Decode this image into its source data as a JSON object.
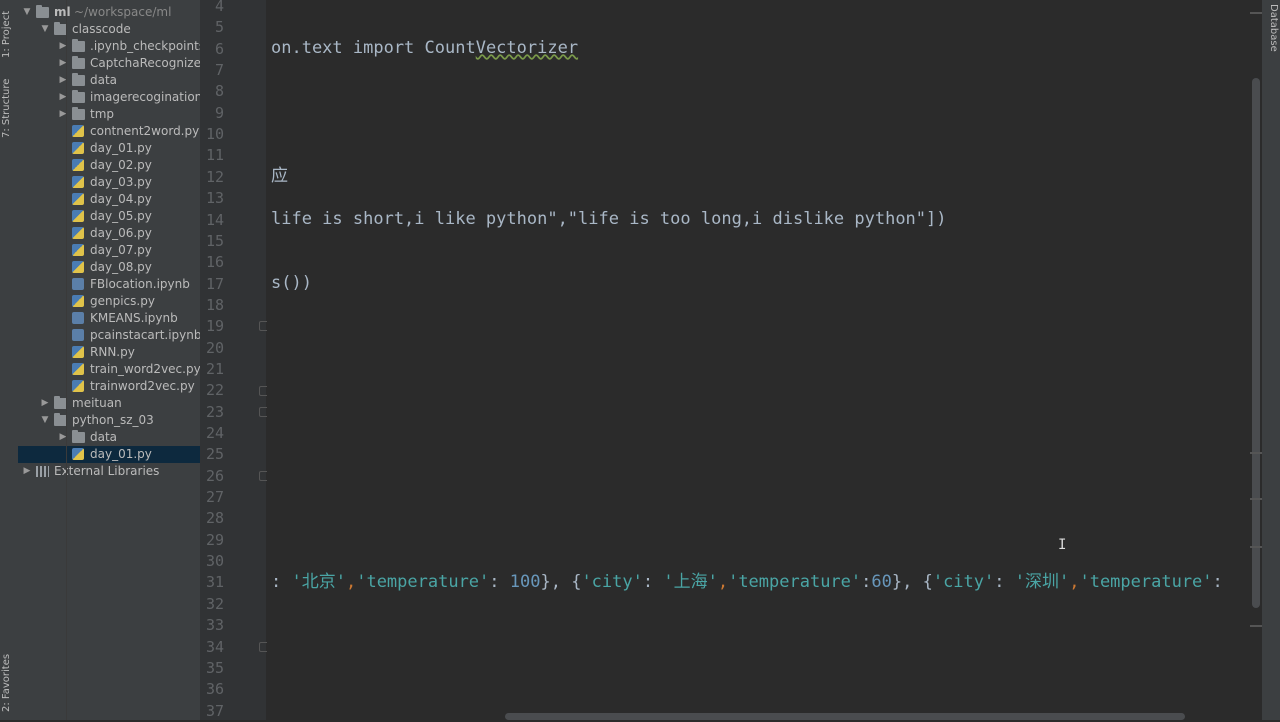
{
  "tool_windows": {
    "project_tab": "1: Project",
    "structure_tab": "7: Structure",
    "favorites_tab": "2: Favorites",
    "database_tab": "Database"
  },
  "project_tree": [
    {
      "label": "ml",
      "sub": "~/workspace/ml",
      "type": "folder",
      "arrow": "▼",
      "depth": 0
    },
    {
      "label": "classcode",
      "type": "folder",
      "arrow": "▼",
      "depth": 1
    },
    {
      "label": ".ipynb_checkpoints",
      "type": "folder",
      "arrow": "▶",
      "depth": 2
    },
    {
      "label": "CaptchaRecognize",
      "type": "folder",
      "arrow": "▶",
      "depth": 2
    },
    {
      "label": "data",
      "type": "folder",
      "arrow": "▶",
      "depth": 2
    },
    {
      "label": "imagerecogination",
      "type": "folder",
      "arrow": "▶",
      "depth": 2
    },
    {
      "label": "tmp",
      "type": "folder",
      "arrow": "▶",
      "depth": 2
    },
    {
      "label": "contnent2word.py",
      "type": "py",
      "depth": 2
    },
    {
      "label": "day_01.py",
      "type": "py",
      "depth": 2
    },
    {
      "label": "day_02.py",
      "type": "py",
      "depth": 2
    },
    {
      "label": "day_03.py",
      "type": "py",
      "depth": 2
    },
    {
      "label": "day_04.py",
      "type": "py",
      "depth": 2
    },
    {
      "label": "day_05.py",
      "type": "py",
      "depth": 2
    },
    {
      "label": "day_06.py",
      "type": "py",
      "depth": 2
    },
    {
      "label": "day_07.py",
      "type": "py",
      "depth": 2
    },
    {
      "label": "day_08.py",
      "type": "py",
      "depth": 2
    },
    {
      "label": "FBlocation.ipynb",
      "type": "nb",
      "depth": 2
    },
    {
      "label": "genpics.py",
      "type": "py",
      "depth": 2
    },
    {
      "label": "KMEANS.ipynb",
      "type": "nb",
      "depth": 2
    },
    {
      "label": "pcainstacart.ipynb",
      "type": "nb",
      "depth": 2
    },
    {
      "label": "RNN.py",
      "type": "py",
      "depth": 2
    },
    {
      "label": "train_word2vec.py",
      "type": "py",
      "depth": 2
    },
    {
      "label": "trainword2vec.py",
      "type": "py",
      "depth": 2
    },
    {
      "label": "meituan",
      "type": "folder",
      "arrow": "▶",
      "depth": 1
    },
    {
      "label": "python_sz_03",
      "type": "folder",
      "arrow": "▼",
      "depth": 1
    },
    {
      "label": "data",
      "type": "folder",
      "arrow": "▶",
      "depth": 2
    },
    {
      "label": "day_01.py",
      "type": "py",
      "depth": 2,
      "selected": true
    },
    {
      "label": "External Libraries",
      "type": "lib",
      "arrow": "▶",
      "depth": 0
    }
  ],
  "line_numbers": [
    "4",
    "5",
    "6",
    "7",
    "8",
    "9",
    "10",
    "11",
    "12",
    "13",
    "14",
    "15",
    "16",
    "17",
    "18",
    "19",
    "20",
    "21",
    "22",
    "23",
    "24",
    "25",
    "26",
    "27",
    "28",
    "29",
    "30",
    "31",
    "32",
    "33",
    "34",
    "35",
    "36",
    "37"
  ],
  "code": {
    "line6": "on.text import Count",
    "line6_wavy": "Vectorizer",
    "line12": "应",
    "line14": "life is short,i like python\",\"life is too long,i dislike python\"])",
    "line17": "s())",
    "line31": [
      {
        "t": ": ",
        "c": "plain"
      },
      {
        "t": "'北京'",
        "c": "str"
      },
      {
        "t": ",",
        "c": "punc"
      },
      {
        "t": "'temperature'",
        "c": "str"
      },
      {
        "t": ": ",
        "c": "plain"
      },
      {
        "t": "100",
        "c": "num"
      },
      {
        "t": "}, {",
        "c": "plain"
      },
      {
        "t": "'city'",
        "c": "str"
      },
      {
        "t": ": ",
        "c": "plain"
      },
      {
        "t": "'上海'",
        "c": "str"
      },
      {
        "t": ",",
        "c": "punc"
      },
      {
        "t": "'temperature'",
        "c": "str"
      },
      {
        "t": ":",
        "c": "plain"
      },
      {
        "t": "60",
        "c": "num"
      },
      {
        "t": "}, {",
        "c": "plain"
      },
      {
        "t": "'city'",
        "c": "str"
      },
      {
        "t": ": ",
        "c": "plain"
      },
      {
        "t": "'深圳'",
        "c": "str"
      },
      {
        "t": ",",
        "c": "punc"
      },
      {
        "t": "'temperature'",
        "c": "str"
      },
      {
        "t": ":",
        "c": "plain"
      }
    ]
  },
  "colors": {
    "background": "#2b2b2b",
    "panel": "#3c3f41",
    "string": "#4aa5a5",
    "number": "#6897bb",
    "selection": "#0d293e"
  }
}
